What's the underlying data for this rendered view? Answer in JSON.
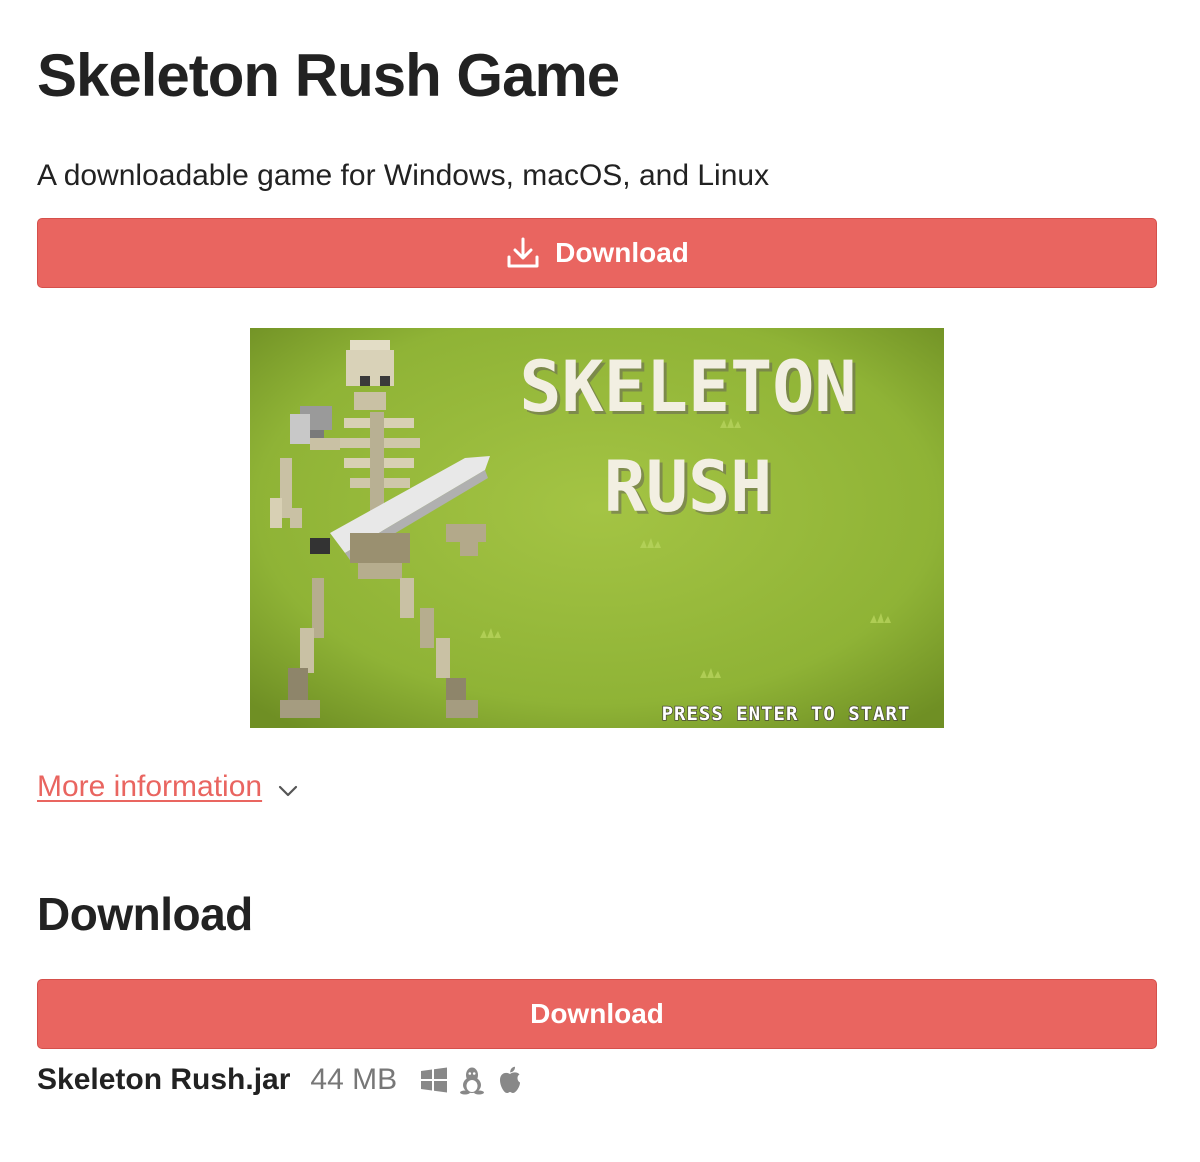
{
  "page": {
    "title": "Skeleton Rush Game",
    "subtitle": "A downloadable game for Windows, macOS, and Linux"
  },
  "top_download": {
    "label": "Download",
    "icon": "download-icon"
  },
  "screenshot": {
    "title_line1": "SKELETON",
    "title_line2": "RUSH",
    "prompt": "PRESS ENTER TO START"
  },
  "more_info": {
    "label": "More information",
    "icon": "chevron-down-icon"
  },
  "download_section": {
    "heading": "Download",
    "button_label": "Download",
    "file": {
      "name": "Skeleton Rush.jar",
      "size": "44 MB",
      "platforms": [
        "windows-icon",
        "linux-icon",
        "apple-icon"
      ]
    }
  },
  "colors": {
    "accent": "#e96560",
    "text": "#222222",
    "muted": "#777777",
    "screenshot_bg": "#98b83c"
  }
}
